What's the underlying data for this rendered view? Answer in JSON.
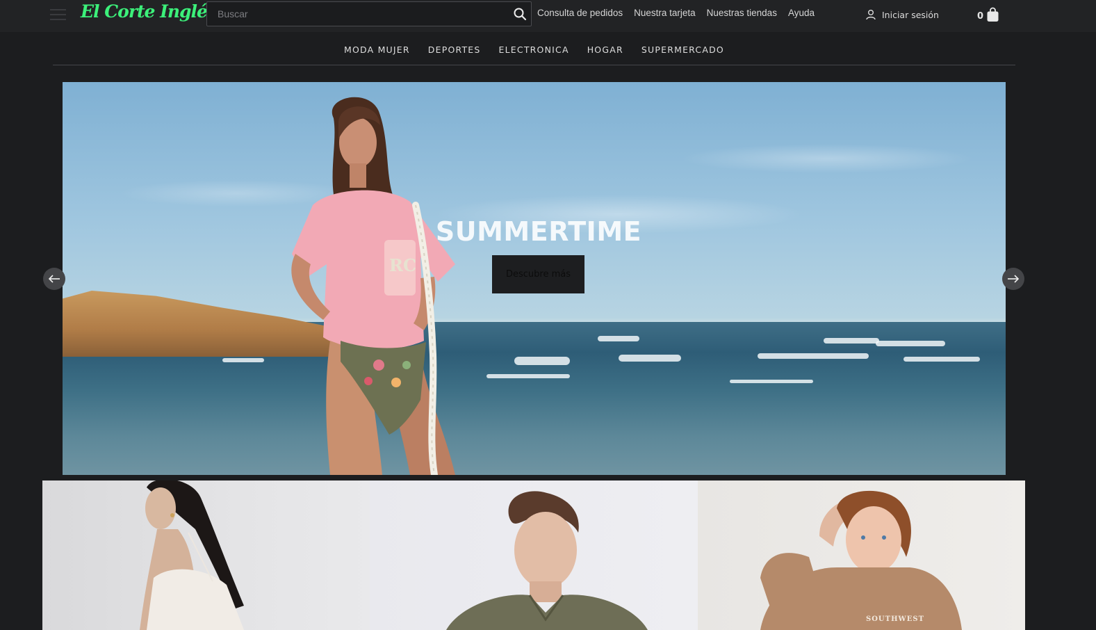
{
  "header": {
    "logo_text": "El Corte Inglés",
    "search": {
      "placeholder": "Buscar",
      "value": ""
    },
    "links": [
      {
        "label": "Consulta de pedidos"
      },
      {
        "label": "Nuestra tarjeta"
      },
      {
        "label": "Nuestras tiendas"
      },
      {
        "label": "Ayuda"
      }
    ],
    "login_label": "Iniciar sesión",
    "cart_count": "0"
  },
  "nav": {
    "categories": [
      {
        "label": "MODA MUJER"
      },
      {
        "label": "DEPORTES"
      },
      {
        "label": "ELECTRONICA"
      },
      {
        "label": "HOGAR"
      },
      {
        "label": "SUPERMERCADO"
      }
    ]
  },
  "hero": {
    "title": "SUMMERTIME",
    "cta_label": "Descubre más",
    "tshirt_print": "RC"
  },
  "tiles": {
    "kids_hoodie_print": "SOUTHWEST"
  },
  "colors": {
    "background": "#1c1d1f",
    "header": "#222325",
    "logo_green": "#3cf07a",
    "hero_button": "#1d1e20"
  },
  "icons": {
    "menu": "hamburger-icon",
    "search": "search-icon",
    "user": "user-icon",
    "cart": "shopping-bag-icon",
    "prev": "arrow-left-icon",
    "next": "arrow-right-icon"
  }
}
